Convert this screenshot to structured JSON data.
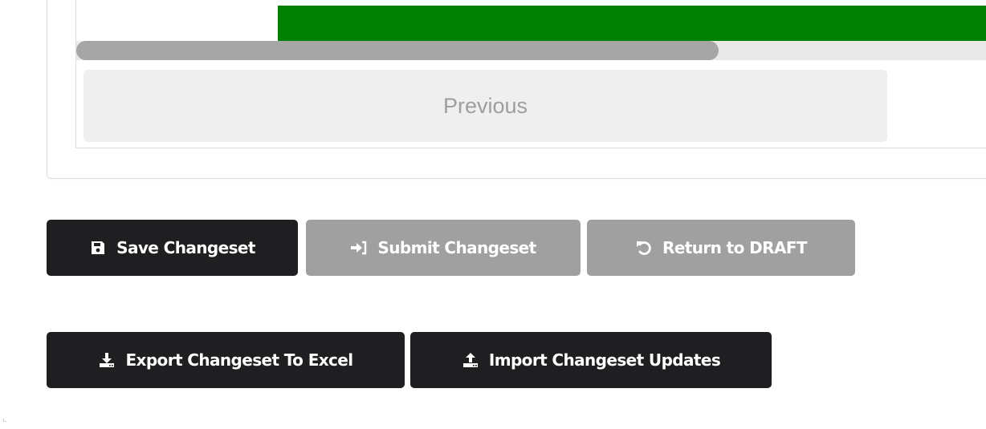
{
  "pagination": {
    "previous_label": "Previous"
  },
  "actions": {
    "save_label": "Save Changeset",
    "submit_label": "Submit Changeset",
    "return_label": "Return to DRAFT",
    "export_label": "Export Changeset To Excel",
    "import_label": "Import Changeset Updates"
  },
  "icons": {
    "save": "floppy-disk-icon",
    "submit": "sign-in-arrow-icon",
    "return": "undo-arrow-icon",
    "export": "download-tray-icon",
    "import": "upload-tray-icon"
  },
  "colors": {
    "status_bar": "#008000",
    "primary_button": "#1f1f22",
    "disabled_button": "#a0a0a0",
    "previous_button_bg": "#efefef",
    "previous_button_text": "#9e9e9e"
  }
}
